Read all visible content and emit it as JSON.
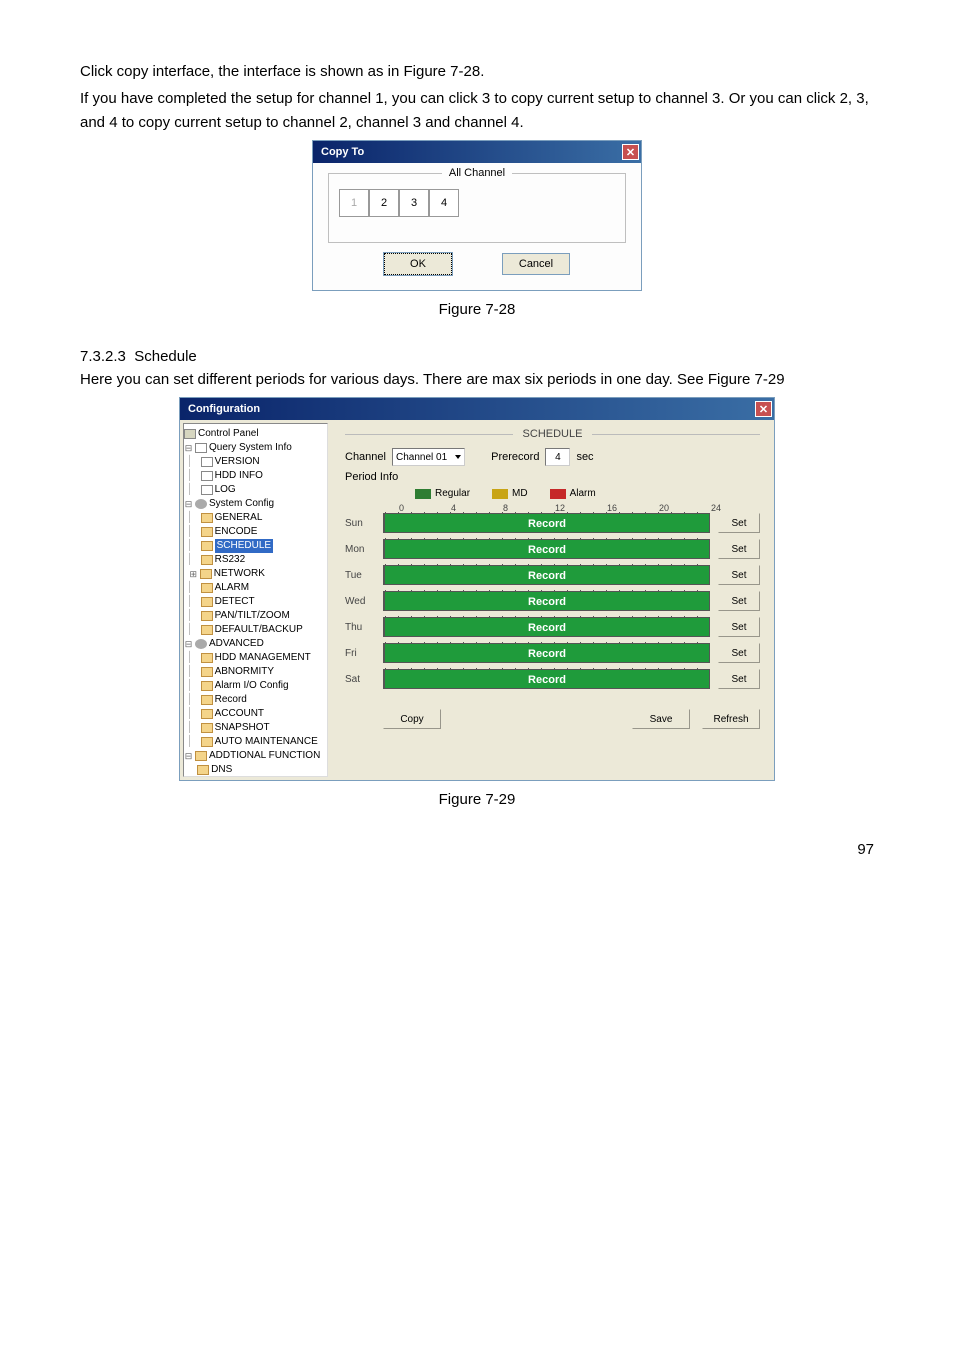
{
  "body_text_1": "Click copy interface, the interface is shown as in Figure 7-28.",
  "body_text_2": "If you have completed the setup for channel 1, you can click 3 to copy current setup to channel 3. Or you can click 2, 3, and 4 to copy current setup to channel 2, channel 3 and channel 4.",
  "copyto": {
    "title": "Copy To",
    "legend": "All Channel",
    "ch1": "1",
    "ch2": "2",
    "ch3": "3",
    "ch4": "4",
    "ok": "OK",
    "cancel": "Cancel"
  },
  "figure_28": "Figure 7-28",
  "section_num": "7.3.2.3",
  "section_title": "Schedule",
  "section_text": "Here you can set different periods for various days. There are max six periods in one day. See Figure 7-29",
  "config": {
    "title": "Configuration",
    "tree": {
      "control_panel": "Control Panel",
      "query": "Query System Info",
      "version": "VERSION",
      "hdd_info": "HDD INFO",
      "log": "LOG",
      "system_config": "System Config",
      "general": "GENERAL",
      "encode": "ENCODE",
      "schedule": "SCHEDULE",
      "rs232": "RS232",
      "network": "NETWORK",
      "alarm": "ALARM",
      "detect": "DETECT",
      "ptz": "PAN/TILT/ZOOM",
      "default": "DEFAULT/BACKUP",
      "advanced": "ADVANCED",
      "hdd_mgmt": "HDD MANAGEMENT",
      "abnormity": "ABNORMITY",
      "alarm_io": "Alarm I/O Config",
      "record": "Record",
      "account": "ACCOUNT",
      "snapshot": "SNAPSHOT",
      "auto_maint": "AUTO MAINTENANCE",
      "addtional": "ADDTIONAL FUNCTION",
      "dns": "DNS"
    },
    "schedule": {
      "title": "SCHEDULE",
      "channel_lbl": "Channel",
      "channel_val": "Channel 01",
      "prerecord_lbl": "Prerecord",
      "prerecord_val": "4",
      "sec": "sec",
      "period_lbl": "Period Info",
      "regular": "Regular",
      "md": "MD",
      "alarm": "Alarm",
      "axis": {
        "t0": "0",
        "t4": "4",
        "t8": "8",
        "t12": "12",
        "t16": "16",
        "t20": "20",
        "t24": "24"
      },
      "days": {
        "sun": "Sun",
        "mon": "Mon",
        "tue": "Tue",
        "wed": "Wed",
        "thu": "Thu",
        "fri": "Fri",
        "sat": "Sat"
      },
      "record": "Record",
      "set": "Set",
      "copy": "Copy",
      "save": "Save",
      "refresh": "Refresh"
    }
  },
  "figure_29": "Figure 7-29",
  "page_num": "97"
}
